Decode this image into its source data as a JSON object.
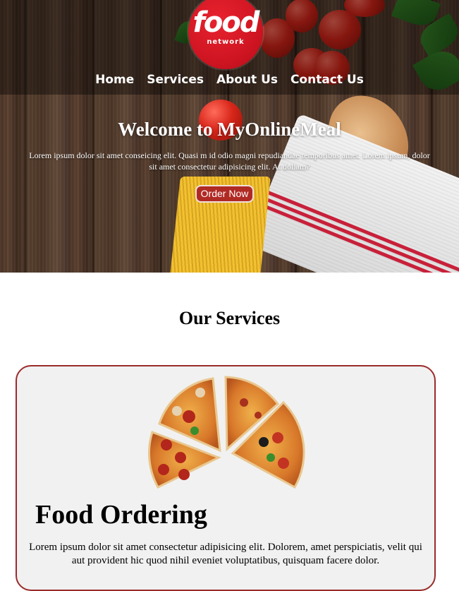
{
  "brand": {
    "logo_word": "food",
    "logo_sub": "network",
    "colors": {
      "logo_red": "#d01522",
      "button_red": "#b02a24",
      "card_border": "#9b2b2b",
      "card_bg": "#f1f1f1"
    }
  },
  "nav": {
    "items": [
      {
        "label": "Home"
      },
      {
        "label": "Services"
      },
      {
        "label": "About Us"
      },
      {
        "label": "Contact Us"
      }
    ]
  },
  "hero": {
    "title": "Welcome to MyOnlineMeal",
    "text": "Lorem ipsum dolor sit amet conseicing elit. Quasi m id odio magni repudiandae temporibus amet. Lorem ipsum, dolor sit amet consectetur adipisicing elit. At dollam?",
    "button_label": "Order Now"
  },
  "services": {
    "title": "Our Services",
    "card": {
      "image": "pizza-slices-image",
      "title": "Food Ordering",
      "text": "Lorem ipsum dolor sit amet consectetur adipisicing elit. Dolorem, amet perspiciatis, velit qui aut provident hic quod nihil eveniet voluptatibus, quisquam facere dolor."
    }
  }
}
